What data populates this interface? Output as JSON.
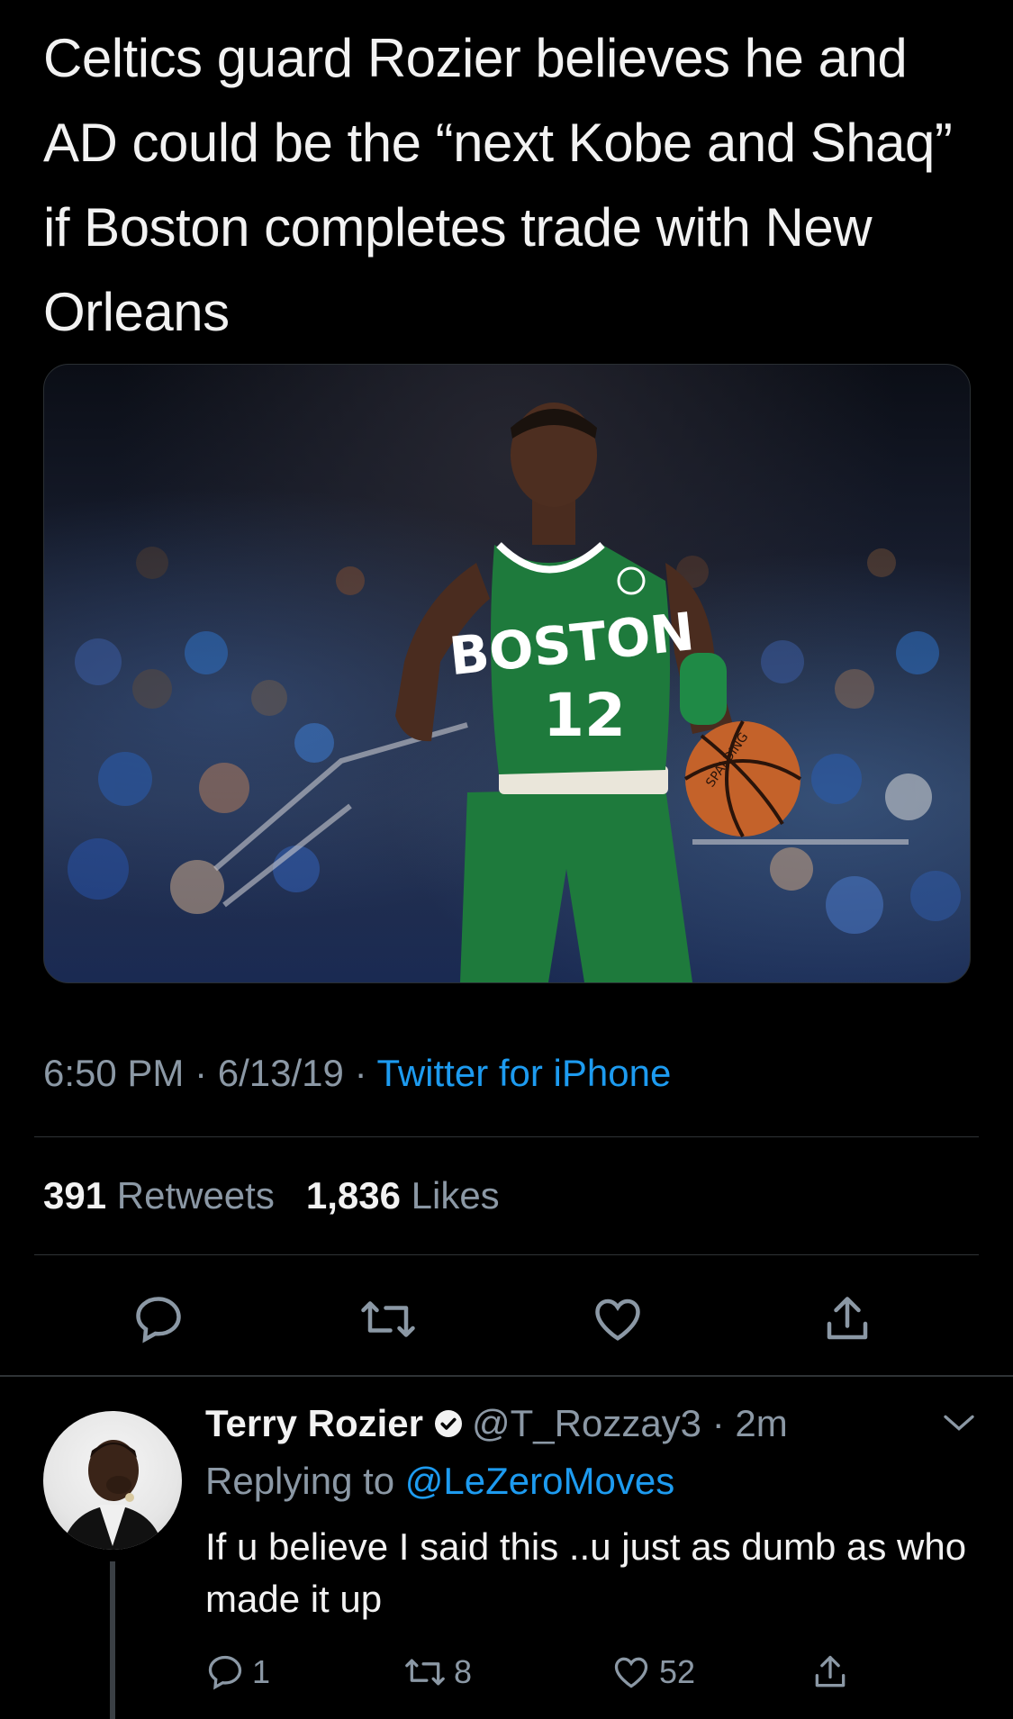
{
  "tweet": {
    "headline": "Celtics guard Rozier believes he and AD could be the “next Kobe and Shaq” if Boston completes trade with New Orleans",
    "image": {
      "jersey_text": "BOSTON",
      "jersey_number": "12",
      "ball_text": "SPALDING"
    },
    "time": "6:50 PM",
    "date": "6/13/19",
    "separator": "·",
    "source": "Twitter for iPhone",
    "retweets_count": "391",
    "retweets_label": "Retweets",
    "likes_count": "1,836",
    "likes_label": "Likes",
    "actions": [
      "reply-icon",
      "retweet-icon",
      "like-icon",
      "share-icon"
    ]
  },
  "reply": {
    "name": "Terry Rozier",
    "handle": "@T_Rozzay3",
    "time": "2m",
    "replying_prefix": "Replying to",
    "replying_to": "@LeZeroMoves",
    "text": "If u believe I said this ..u just as dumb as who made it up",
    "reply_count": "1",
    "retweet_count": "8",
    "like_count": "52"
  },
  "colors": {
    "background": "#000000",
    "text": "#f2f2f2",
    "secondary": "#8b98a5",
    "link": "#1d9bf0",
    "divider": "#2f3336",
    "jersey": "#1e7a3c"
  }
}
